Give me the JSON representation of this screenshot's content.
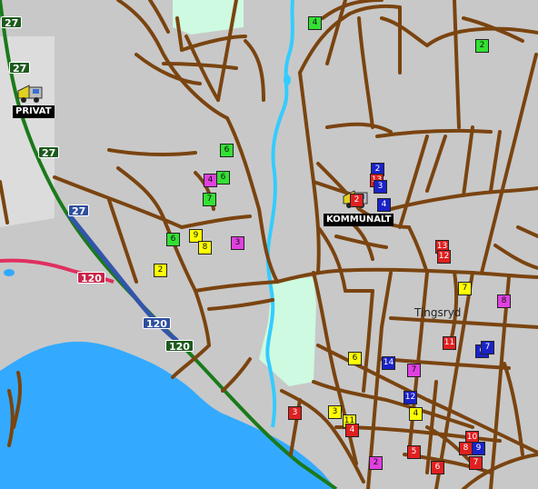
{
  "map": {
    "town_name": "Tingsryd",
    "depots": [
      {
        "id": "privat",
        "label": "PRIVAT"
      },
      {
        "id": "kommunalt",
        "label": "KOMMUNALT"
      }
    ],
    "route_shields": [
      {
        "id": "r27a",
        "text": "27",
        "color": "green"
      },
      {
        "id": "r27b",
        "text": "27",
        "color": "green"
      },
      {
        "id": "r27c",
        "text": "27",
        "color": "green"
      },
      {
        "id": "r27d",
        "text": "27",
        "color": "blue"
      },
      {
        "id": "r120a",
        "text": "120",
        "color": "red"
      },
      {
        "id": "r120b",
        "text": "120",
        "color": "blue"
      },
      {
        "id": "r120c",
        "text": "120",
        "color": "green"
      }
    ],
    "marker_colors": {
      "green": "#33e033",
      "magenta": "#e040e0",
      "yellow": "#ffff00",
      "blue": "#1a22c8",
      "red": "#e02020"
    },
    "markers": [
      {
        "n": "4",
        "c": "green"
      },
      {
        "n": "2",
        "c": "green"
      },
      {
        "n": "6",
        "c": "green"
      },
      {
        "n": "4",
        "c": "magenta"
      },
      {
        "n": "6",
        "c": "green"
      },
      {
        "n": "7",
        "c": "green"
      },
      {
        "n": "6",
        "c": "green"
      },
      {
        "n": "9",
        "c": "yellow"
      },
      {
        "n": "8",
        "c": "yellow"
      },
      {
        "n": "3",
        "c": "magenta"
      },
      {
        "n": "2",
        "c": "yellow"
      },
      {
        "n": "2",
        "c": "blue"
      },
      {
        "n": "13",
        "c": "red"
      },
      {
        "n": "3",
        "c": "blue"
      },
      {
        "n": "2",
        "c": "red"
      },
      {
        "n": "4",
        "c": "blue"
      },
      {
        "n": "13",
        "c": "red"
      },
      {
        "n": "12",
        "c": "red"
      },
      {
        "n": "7",
        "c": "yellow"
      },
      {
        "n": "8",
        "c": "magenta"
      },
      {
        "n": "11",
        "c": "red"
      },
      {
        "n": "6",
        "c": "blue"
      },
      {
        "n": "7",
        "c": "blue"
      },
      {
        "n": "6",
        "c": "yellow"
      },
      {
        "n": "14",
        "c": "blue"
      },
      {
        "n": "7",
        "c": "magenta"
      },
      {
        "n": "12",
        "c": "blue"
      },
      {
        "n": "3",
        "c": "red"
      },
      {
        "n": "3",
        "c": "yellow"
      },
      {
        "n": "11",
        "c": "yellow"
      },
      {
        "n": "4",
        "c": "red"
      },
      {
        "n": "4",
        "c": "yellow"
      },
      {
        "n": "10",
        "c": "red"
      },
      {
        "n": "8",
        "c": "red"
      },
      {
        "n": "9",
        "c": "blue"
      },
      {
        "n": "5",
        "c": "red"
      },
      {
        "n": "7",
        "c": "red"
      },
      {
        "n": "2",
        "c": "magenta"
      },
      {
        "n": "6",
        "c": "red"
      }
    ]
  }
}
